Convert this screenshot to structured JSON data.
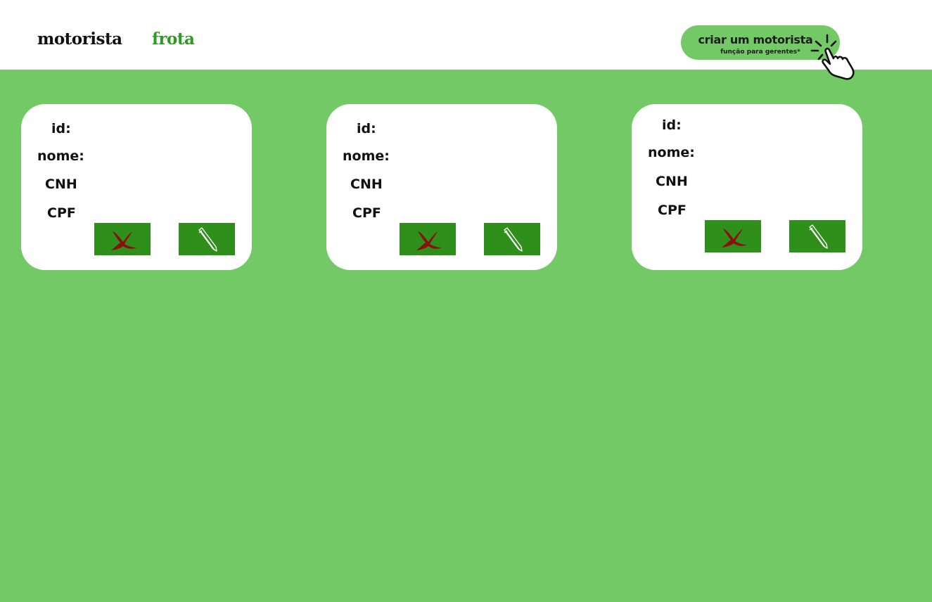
{
  "nav": {
    "motorista_label": "motorista",
    "frota_label": "frota"
  },
  "create_button": {
    "label": "criar um motorista",
    "sublabel": "função para gerentes*",
    "icon": "click-hand-icon"
  },
  "cards": [
    {
      "id_label": "id:",
      "nome_label": "nome:",
      "cnh_label": "CNH",
      "cpf_label": "CPF",
      "delete_icon": "delete-x-icon",
      "edit_icon": "pencil-icon"
    },
    {
      "id_label": "id:",
      "nome_label": "nome:",
      "cnh_label": "CNH",
      "cpf_label": "CPF",
      "delete_icon": "delete-x-icon",
      "edit_icon": "pencil-icon"
    },
    {
      "id_label": "id:",
      "nome_label": "nome:",
      "cnh_label": "CNH",
      "cpf_label": "CPF",
      "delete_icon": "delete-x-icon",
      "edit_icon": "pencil-icon"
    }
  ],
  "colors": {
    "background": "#72c965",
    "header": "#ffffff",
    "action_button": "#2e8f1a",
    "delete_mark": "#8b0f0f",
    "frota_link": "#2e9a22"
  }
}
